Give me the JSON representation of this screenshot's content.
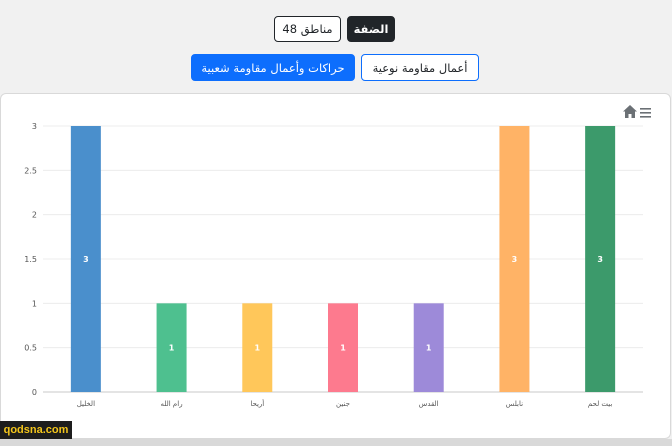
{
  "buttons": {
    "west_bank": "الضفة",
    "areas_48": "مناطق 48",
    "popular_resistance": "حراكات وأعمال مقاومة شعبية",
    "qualitative_resistance": "أعمال مقاومة نوعية"
  },
  "watermark": "qodsna.com",
  "chart_data": {
    "type": "bar",
    "categories": [
      "الخليل",
      "رام الله",
      "أريحا",
      "جنين",
      "القدس",
      "نابلس",
      "بيت لحم"
    ],
    "values": [
      3,
      1,
      1,
      1,
      1,
      3,
      3
    ],
    "colors": [
      "#4a8fcc",
      "#4ec08f",
      "#ffc75a",
      "#fd7a8e",
      "#9d8ad9",
      "#ffb366",
      "#3c9a6b"
    ],
    "value_labels": [
      "3",
      "1",
      "1",
      "1",
      "1",
      "3",
      "3"
    ],
    "y_ticks": [
      "0",
      "0.5",
      "1",
      "1.5",
      "2",
      "2.5",
      "3"
    ],
    "ylim": [
      0,
      3
    ],
    "grid": true,
    "legend": "none",
    "toolbar_icons": [
      "home-icon",
      "menu-icon"
    ]
  }
}
